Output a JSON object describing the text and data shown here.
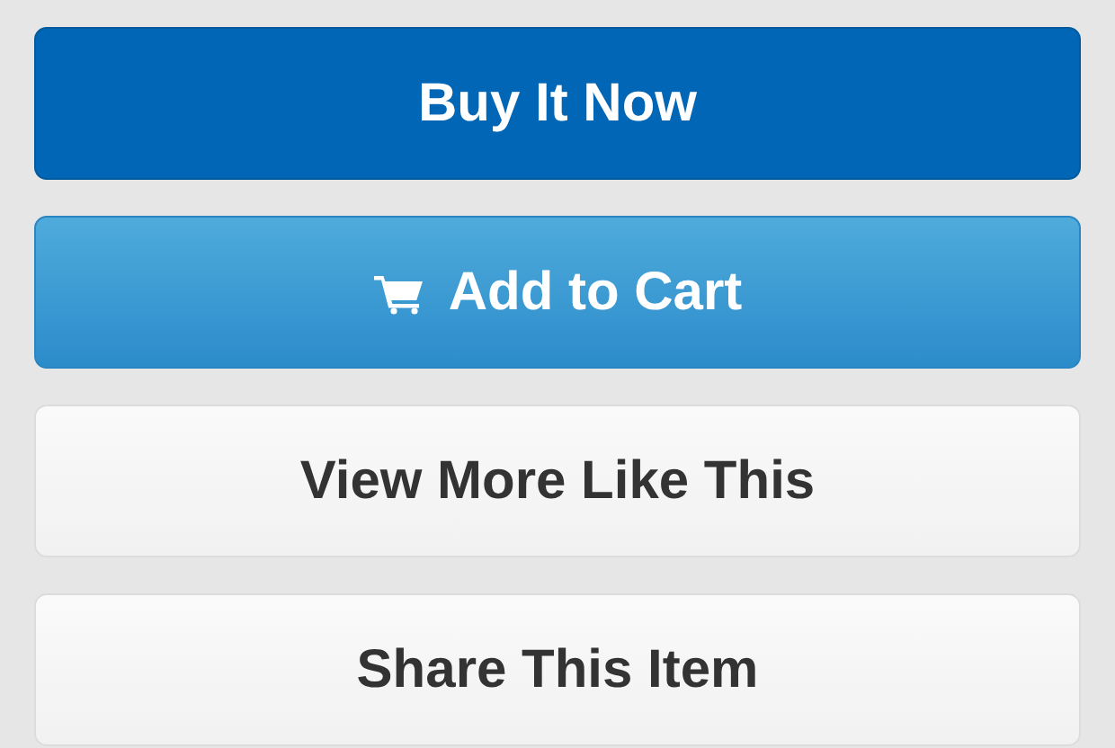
{
  "buttons": [
    {
      "label": "Buy It Now",
      "kind": "primary"
    },
    {
      "label": "Add to Cart",
      "kind": "cart"
    },
    {
      "label": "View More Like This",
      "kind": "plain"
    },
    {
      "label": "Share This Item",
      "kind": "plain"
    }
  ]
}
